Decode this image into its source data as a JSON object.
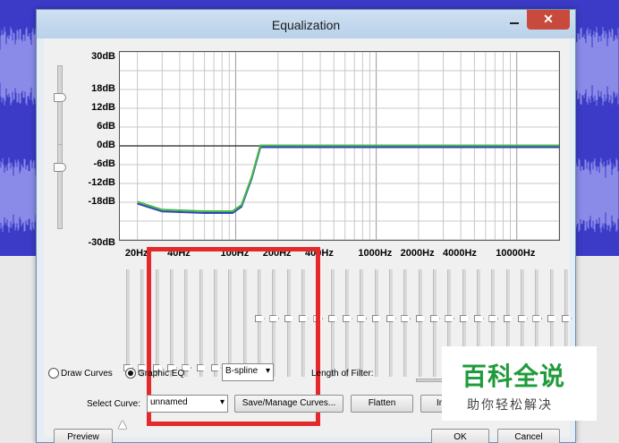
{
  "window": {
    "title": "Equalization",
    "close_glyph": "✕"
  },
  "db_ticks": [
    "30dB",
    "18dB",
    "12dB",
    "6dB",
    "0dB",
    "-6dB",
    "-12dB",
    "-18dB",
    "-30dB"
  ],
  "hz_ticks": [
    "20Hz",
    "40Hz",
    "100Hz",
    "200Hz",
    "400Hz",
    "1000Hz",
    "2000Hz",
    "4000Hz",
    "10000Hz"
  ],
  "curve_points": [
    {
      "hz": 20,
      "db": -18
    },
    {
      "hz": 30,
      "db": -20.5
    },
    {
      "hz": 60,
      "db": -21
    },
    {
      "hz": 95,
      "db": -21
    },
    {
      "hz": 110,
      "db": -19
    },
    {
      "hz": 130,
      "db": -10
    },
    {
      "hz": 150,
      "db": 0
    },
    {
      "hz": 200,
      "db": 0
    },
    {
      "hz": 20000,
      "db": 0
    }
  ],
  "band_levels": [
    -30,
    -30,
    -30,
    -30,
    -30,
    -30,
    -30,
    -30,
    -30,
    0,
    0,
    0,
    0,
    0,
    0,
    0,
    0,
    0,
    0,
    0,
    0,
    0,
    0,
    0,
    0,
    0,
    0,
    0,
    0,
    0,
    0
  ],
  "mode": {
    "draw_curves_label": "Draw Curves",
    "graphic_eq_label": "Graphic EQ",
    "selected": "graphic_eq",
    "interpolation": "B-spline"
  },
  "filter": {
    "length_label": "Length of Filter:"
  },
  "curve": {
    "select_label": "Select Curve:",
    "selected_curve": "unnamed"
  },
  "buttons": {
    "save_manage": "Save/Manage Curves...",
    "flatten": "Flatten",
    "invert_partial": "In",
    "preview": "Preview",
    "ok": "OK",
    "cancel": "Cancel"
  },
  "watermark": {
    "main": "百科全说",
    "sub": "助你轻松解决"
  },
  "colors": {
    "curve_blue": "#3344bb",
    "curve_green": "#44bb44",
    "highlight_red": "#e5282a",
    "close_red": "#c74a3c",
    "watermark_green": "#1f9b3a"
  }
}
